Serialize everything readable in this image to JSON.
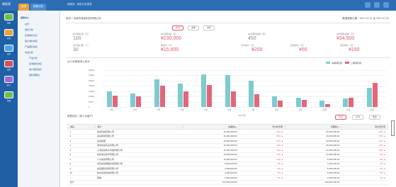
{
  "topbar": {
    "logo": "微报表",
    "tabs": [
      "首页",
      "销售分析"
    ],
    "title": "微报表 - 销售分析报表"
  },
  "rail": [
    "报表",
    "分析",
    "查询",
    "设置",
    "统计",
    "管理",
    "工具"
  ],
  "tree": {
    "root": "报表中心",
    "items": [
      "总览",
      "销售分析",
      "区域销售对比",
      "客户销售排名",
      "产品销售排名",
      "商品分析",
      "产品分析",
      "区域销售排名",
      "客户销售报表",
      "销售明细表"
    ]
  },
  "main": {
    "breadcrumb": "首页 > 深圳市某某科技有限公司",
    "breadcrumb_right": "数据更新日期：2017-07-01 至 2017-07-31",
    "filter_buttons": [
      "本月",
      "本季",
      "本年"
    ],
    "kpis": [
      {
        "label": "本月销售额（元）",
        "value": "100",
        "color": "gray"
      },
      {
        "label": "本月销售额（元）",
        "value": "¥230,000",
        "color": "red"
      },
      {
        "label": "本月销售数量（件）",
        "value": "450",
        "color": "gray"
      },
      {
        "label": "本月销售金额（元）",
        "value": "¥34,500",
        "color": "red"
      },
      {
        "label": "本月客户数（个）",
        "value": "30",
        "color": "gray"
      },
      {
        "label": "客单价（元）",
        "value": "¥15,600",
        "color": "red"
      },
      {
        "label": "平均单价（元）",
        "value": "¥200",
        "color": "red"
      },
      {
        "label": "最低单价（元）",
        "value": "¥50",
        "color": "red"
      },
      {
        "label": "最高单价（元）",
        "value": "¥150",
        "color": "red"
      }
    ],
    "chart_title": "近12月销售收入统计",
    "legend": [
      "本期销售额",
      "上期销售额"
    ],
    "table_title": "销售排名（前十名客户）",
    "table_buttons": [
      "导出",
      "打印",
      "更多"
    ]
  },
  "chart_data": {
    "type": "bar",
    "categories": [
      "1月",
      "2月",
      "3月",
      "4月",
      "5月",
      "6月",
      "7月",
      "8月",
      "9月",
      "10月",
      "11月",
      "12月"
    ],
    "series": [
      {
        "name": "本期销售额",
        "values": [
          15000,
          13000,
          26000,
          22000,
          31000,
          30000,
          25000,
          10000,
          9000,
          6000,
          8000,
          18000
        ]
      },
      {
        "name": "上期销售额",
        "values": [
          11000,
          10000,
          20000,
          15000,
          21000,
          15000,
          12000,
          6000,
          7000,
          3000,
          9000,
          23000
        ]
      }
    ],
    "ylim": [
      0,
      35000
    ],
    "yticks": [
      "35000",
      "30000",
      "25000",
      "20000",
      "15000",
      "10000",
      "5000",
      "0"
    ],
    "xlabel": "2017年",
    "legend_position": "top-right",
    "colors": [
      "#7ccbd0",
      "#e2667a"
    ]
  },
  "table": {
    "headers": [
      "排名",
      "客户",
      "本期收入",
      "环比增长率",
      "同期收入",
      "同比增长率"
    ],
    "rows": [
      [
        "1",
        "某某科技有限公司",
        "34,000,000.00",
        "30%",
        "30,000,000.00",
        "20%"
      ],
      [
        "2",
        "某某贸易有限公司",
        "30,000,000.00",
        "25%",
        "23,000,000.00",
        "15%"
      ],
      [
        "3",
        "某某集团",
        "23,000,000.00",
        "20%",
        "20,000,000.00",
        "13%"
      ],
      [
        "4",
        "深圳某某实业有限公司",
        "20,000,000.00",
        "18%",
        "16,000,000.00",
        "12%"
      ],
      [
        "5",
        "上海某某电子科技有限公司",
        "15,000,000.00",
        "15%",
        "15,000,000.00",
        "10%"
      ],
      [
        "6",
        "某某信息技术有限公司",
        "12,000,000.00",
        "12%",
        "10,000,000.00",
        "9%"
      ],
      [
        "7",
        "广州某某有限公司",
        "10,000,000.00",
        "10%",
        "9,000,000.00",
        "8%"
      ],
      [
        "8",
        "北京某某网络科技有限公司",
        "8,000,000.00",
        "9%",
        "7,000,000.00",
        "7%"
      ],
      [
        "9",
        "某某国际贸易有限公司",
        "6,000,000.00",
        "8%",
        "5,000,000.00",
        "6%"
      ],
      [
        "10",
        "杭州某某科技有限公司",
        "4,000,000.00",
        "6%",
        "4,000,000.00",
        "5%"
      ],
      [
        "",
        "其他",
        "2,000,000.00",
        "5%",
        "1,000,000.00",
        "4%"
      ]
    ],
    "total": [
      "合计",
      "",
      "164,000,000.00",
      "",
      "140,000,000.00",
      ""
    ]
  }
}
